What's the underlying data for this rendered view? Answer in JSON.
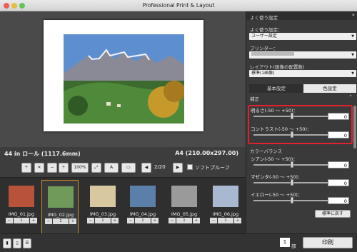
{
  "window": {
    "title": "Professional Print & Layout"
  },
  "preview": {
    "roll_info": "44 in ロール (1117.6mm)",
    "paper_size": "A4 (210.00x297.00)"
  },
  "toolbar": {
    "zoom": "100%",
    "text_btn": "A",
    "page_counter": "2/20",
    "softproof_label": "ソフトプルーフ"
  },
  "thumbnails": [
    {
      "name": "IMG_01.jpg",
      "copies": "1",
      "color": "#b8523a"
    },
    {
      "name": "IMG_02.jpg",
      "copies": "1",
      "color": "#6f9a5a"
    },
    {
      "name": "IMG_03.jpg",
      "copies": "1",
      "color": "#d8c8a0"
    },
    {
      "name": "IMG_04.jpg",
      "copies": "1",
      "color": "#5a7fa8"
    },
    {
      "name": "IMG_05.jpg",
      "copies": "1",
      "color": "#9a9a9a"
    },
    {
      "name": "IMG_06.jpg",
      "copies": "1",
      "color": "#a8b8d0"
    }
  ],
  "sidebar": {
    "header": "よく使う設定",
    "fav_label": "よく使う設定：",
    "fav_value": "ユーザー設定",
    "printer_label": "プリンター：",
    "printer_value": "",
    "layout_label": "レイアウト(画像の配置数)",
    "layout_value": "標準(1画像)",
    "tab_basic": "基本設定",
    "tab_color": "色設定",
    "section": "補正",
    "brightness_label": "明るさ(-50 ～ +50)：",
    "brightness_value": "0",
    "contrast_label": "コントラスト(-50 ～ +50)：",
    "contrast_value": "0",
    "balance_title": "カラーバランス",
    "cyan_label": "シアン(-50 ～ +50)：",
    "cyan_value": "0",
    "magenta_label": "マゼンタ(-50 ～ +50)：",
    "magenta_value": "0",
    "yellow_label": "イエロー(-50 ～ +50)：",
    "yellow_value": "0",
    "reset_label": "標準に戻す"
  },
  "bottom": {
    "copies": "1",
    "copies_unit": "部",
    "print_label": "印刷"
  },
  "colors": {
    "highlight": "#e2222a",
    "selected_thumb": "#d08a2a"
  }
}
